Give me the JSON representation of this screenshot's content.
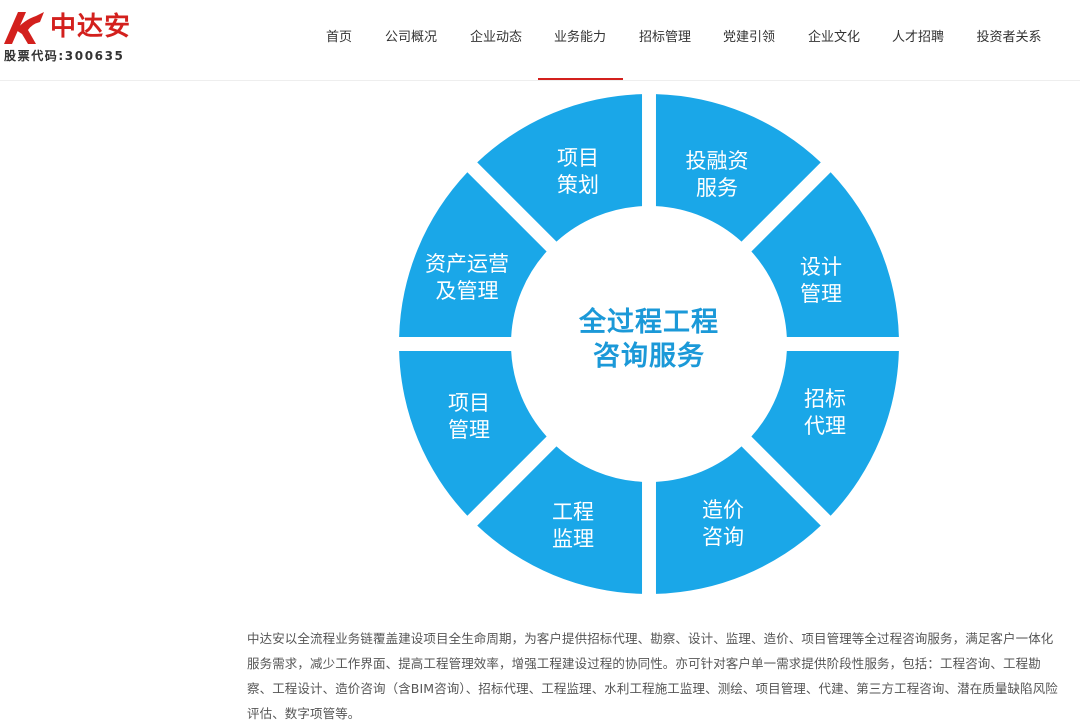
{
  "logo": {
    "name": "中达安",
    "stock_code": "股票代码:300635",
    "brand_color": "#d3201d"
  },
  "nav": {
    "items": [
      {
        "label": "首页"
      },
      {
        "label": "公司概况"
      },
      {
        "label": "企业动态"
      },
      {
        "label": "业务能力",
        "active": true
      },
      {
        "label": "招标管理"
      },
      {
        "label": "党建引领"
      },
      {
        "label": "企业文化"
      },
      {
        "label": "人才招聘"
      },
      {
        "label": "投资者关系"
      }
    ]
  },
  "diagram": {
    "center_line1": "全过程工程",
    "center_line2": "咨询服务",
    "segment_color": "#1aa7e8",
    "center_color": "#1b99d8",
    "segments": [
      {
        "line1": "项目",
        "line2": "策划"
      },
      {
        "line1": "投融资",
        "line2": "服务"
      },
      {
        "line1": "设计",
        "line2": "管理"
      },
      {
        "line1": "招标",
        "line2": "代理"
      },
      {
        "line1": "造价",
        "line2": "咨询"
      },
      {
        "line1": "工程",
        "line2": "监理"
      },
      {
        "line1": "项目",
        "line2": "管理"
      },
      {
        "line1": "资产运营",
        "line2": "及管理"
      }
    ]
  },
  "description": "中达安以全流程业务链覆盖建设项目全生命周期，为客户提供招标代理、勘察、设计、监理、造价、项目管理等全过程咨询服务，满足客户一体化服务需求，减少工作界面、提高工程管理效率，增强工程建设过程的协同性。亦可针对客户单一需求提供阶段性服务，包括：工程咨询、工程勘察、工程设计、造价咨询（含BIM咨询）、招标代理、工程监理、水利工程施工监理、测绘、项目管理、代建、第三方工程咨询、潜在质量缺陷风险评估、数字项管等。"
}
